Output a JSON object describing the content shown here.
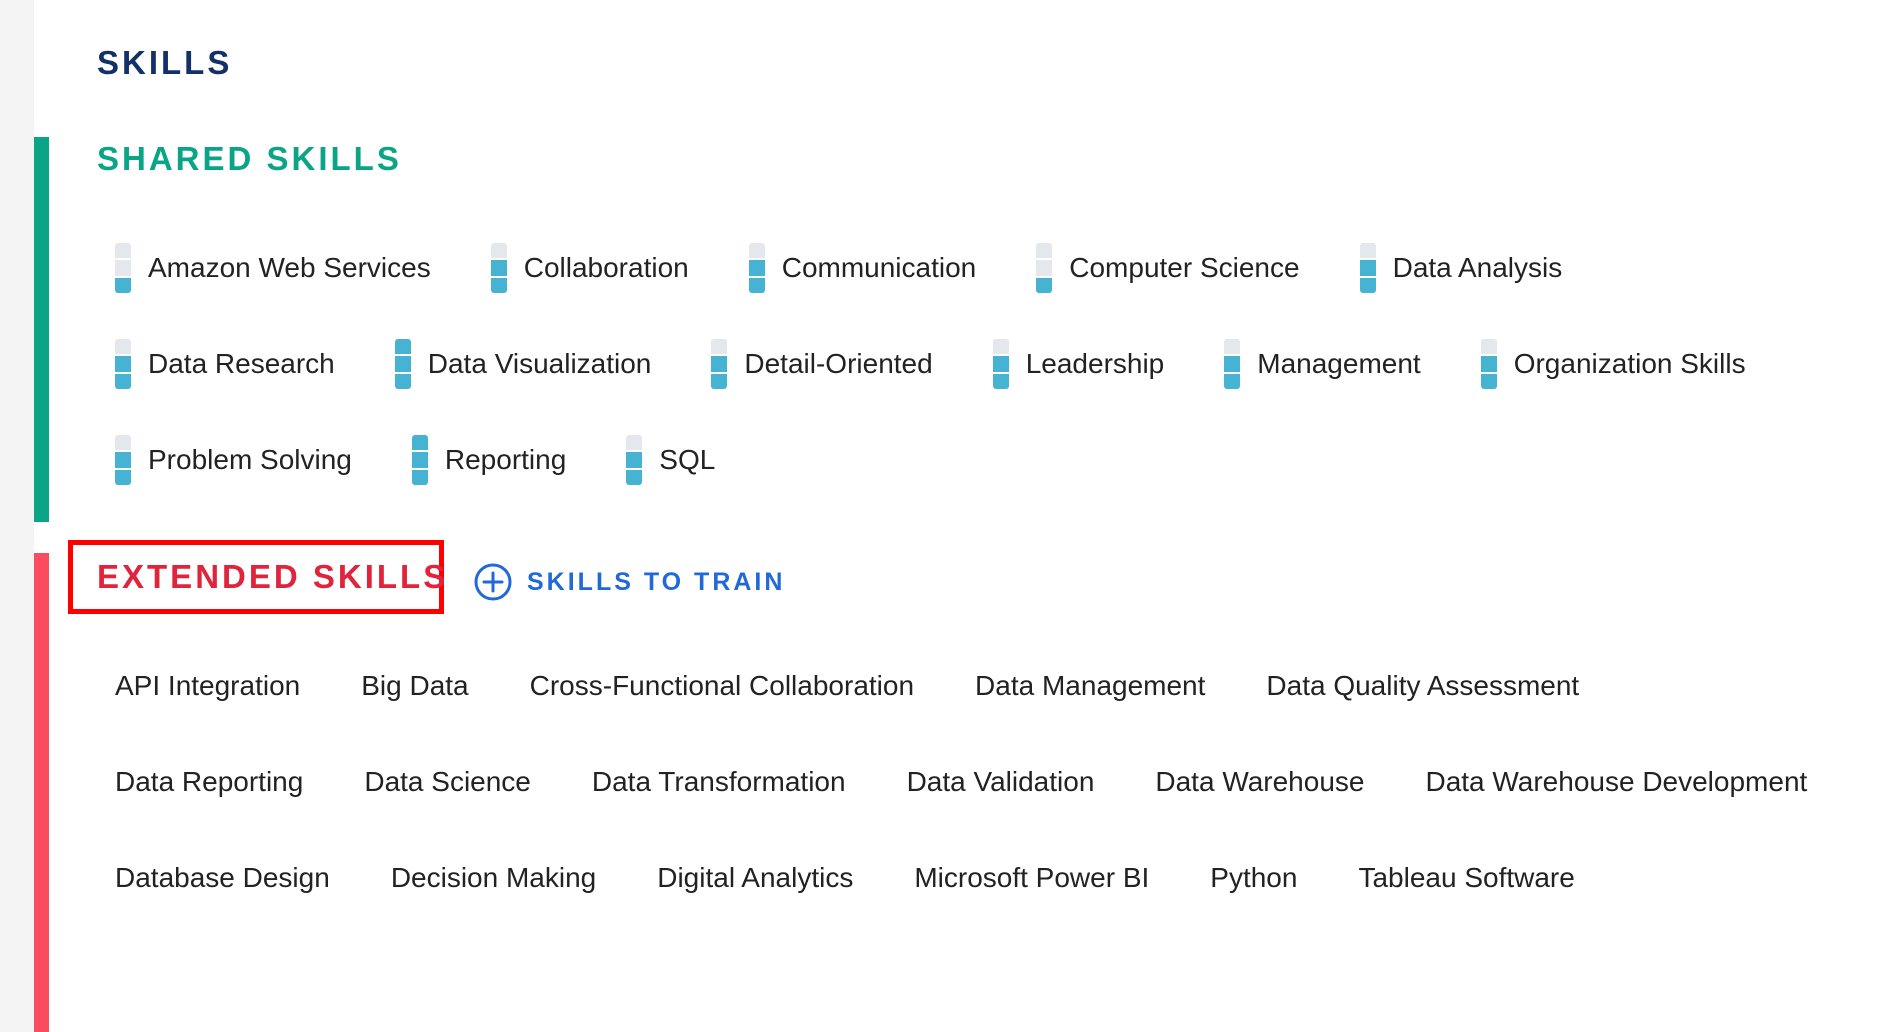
{
  "header": {
    "title": "SKILLS"
  },
  "shared": {
    "title": "SHARED SKILLS",
    "level_colors": {
      "filled": "#47b3d3",
      "empty": "#e4e7eb"
    },
    "items": [
      {
        "label": "Amazon Web Services",
        "level": 1
      },
      {
        "label": "Collaboration",
        "level": 2
      },
      {
        "label": "Communication",
        "level": 2
      },
      {
        "label": "Computer Science",
        "level": 1
      },
      {
        "label": "Data Analysis",
        "level": 2
      },
      {
        "label": "Data Research",
        "level": 2
      },
      {
        "label": "Data Visualization",
        "level": 3
      },
      {
        "label": "Detail-Oriented",
        "level": 2
      },
      {
        "label": "Leadership",
        "level": 2
      },
      {
        "label": "Management",
        "level": 2
      },
      {
        "label": "Organization Skills",
        "level": 2
      },
      {
        "label": "Problem Solving",
        "level": 2
      },
      {
        "label": "Reporting",
        "level": 3
      },
      {
        "label": "SQL",
        "level": 2
      }
    ]
  },
  "extended": {
    "title": "EXTENDED SKILLS",
    "train_link": {
      "label": "SKILLS TO TRAIN",
      "icon": "plus-circle-icon"
    },
    "items": [
      "API Integration",
      "Big Data",
      "Cross-Functional Collaboration",
      "Data Management",
      "Data Quality Assessment",
      "Data Reporting",
      "Data Science",
      "Data Transformation",
      "Data Validation",
      "Data Warehouse",
      "Data Warehouse Development",
      "Database Design",
      "Decision Making",
      "Digital Analytics",
      "Microsoft Power BI",
      "Python",
      "Tableau Software"
    ]
  },
  "colors": {
    "title": "#14306a",
    "shared_accent": "#0aa587",
    "extended_accent": "#fb4b5e",
    "link": "#2269d8",
    "highlight_box": "#ff0000"
  }
}
